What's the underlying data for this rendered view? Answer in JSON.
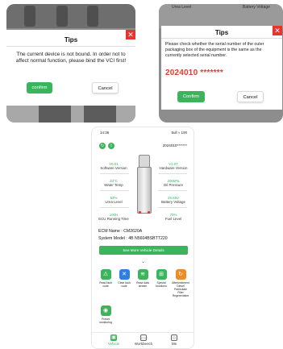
{
  "dialog1": {
    "title": "Tips",
    "close_glyph": "✕",
    "message": "The current device is not bound. In order not to affect normal function, please bind the VCI first!",
    "confirm_label": "confirm",
    "cancel_label": "Cancel"
  },
  "dialog2": {
    "bg_label_left": "Urea Level",
    "bg_label_right": "Battery Voltage",
    "title": "Tips",
    "close_glyph": "✕",
    "message": "Please check whether the serial number of the outer packaging box of the equipment is the same as the currently selected serial number.",
    "serial": "2024010 *******",
    "confirm_label": "Confirm",
    "cancel_label": "Cancel"
  },
  "phone": {
    "status": {
      "time": "14:36",
      "icons": "5ull ≈ 100"
    },
    "serial": "2024010*******",
    "metrics": [
      {
        "value": "V6.01",
        "label": "Software Version"
      },
      {
        "value": "V1.07",
        "label": "Hardware Version"
      },
      {
        "value": "33°C",
        "label": "Water Temp"
      },
      {
        "value": "206kPa",
        "label": "Oil Pressure"
      },
      {
        "value": "53%",
        "label": "Urea Level"
      },
      {
        "value": "25.65V",
        "label": "Battery Voltage"
      },
      {
        "value": "100H",
        "label": "ECU Running Time"
      },
      {
        "value": "70%",
        "label": "Fuel Level"
      }
    ],
    "ecm_name": "ECM Name : CM2620A",
    "system_model": "System Model : 4B N5604BSBTT220",
    "more_button": "See More Vehicle Details",
    "chevron": "⌄",
    "functions": [
      {
        "icon": "read-fault-code-icon",
        "color": "#3bb45b",
        "glyph": "⚠",
        "label": "Read fault code"
      },
      {
        "icon": "clear-fault-code-icon",
        "color": "#2f7fe0",
        "glyph": "✕",
        "label": "Clear fault code"
      },
      {
        "icon": "read-data-stream-icon",
        "color": "#3bb45b",
        "glyph": "≋",
        "label": "Read data stream"
      },
      {
        "icon": "special-functions-icon",
        "color": "#3bb45b",
        "glyph": "⊞",
        "label": "Special functions"
      },
      {
        "icon": "aftertreatment-icon",
        "color": "#f08a24",
        "glyph": "↻",
        "label": "Aftertreatment Diesel Particulate Filter Regeneration"
      },
      {
        "icon": "preset-monitoring-icon",
        "color": "#3bb45b",
        "glyph": "◉",
        "label": "Preset monitoring"
      }
    ],
    "tabs": [
      {
        "label": "Vehicle",
        "glyph": "▣"
      },
      {
        "label": "Workbench",
        "glyph": "▭"
      },
      {
        "label": "Me",
        "glyph": "☺"
      }
    ]
  }
}
